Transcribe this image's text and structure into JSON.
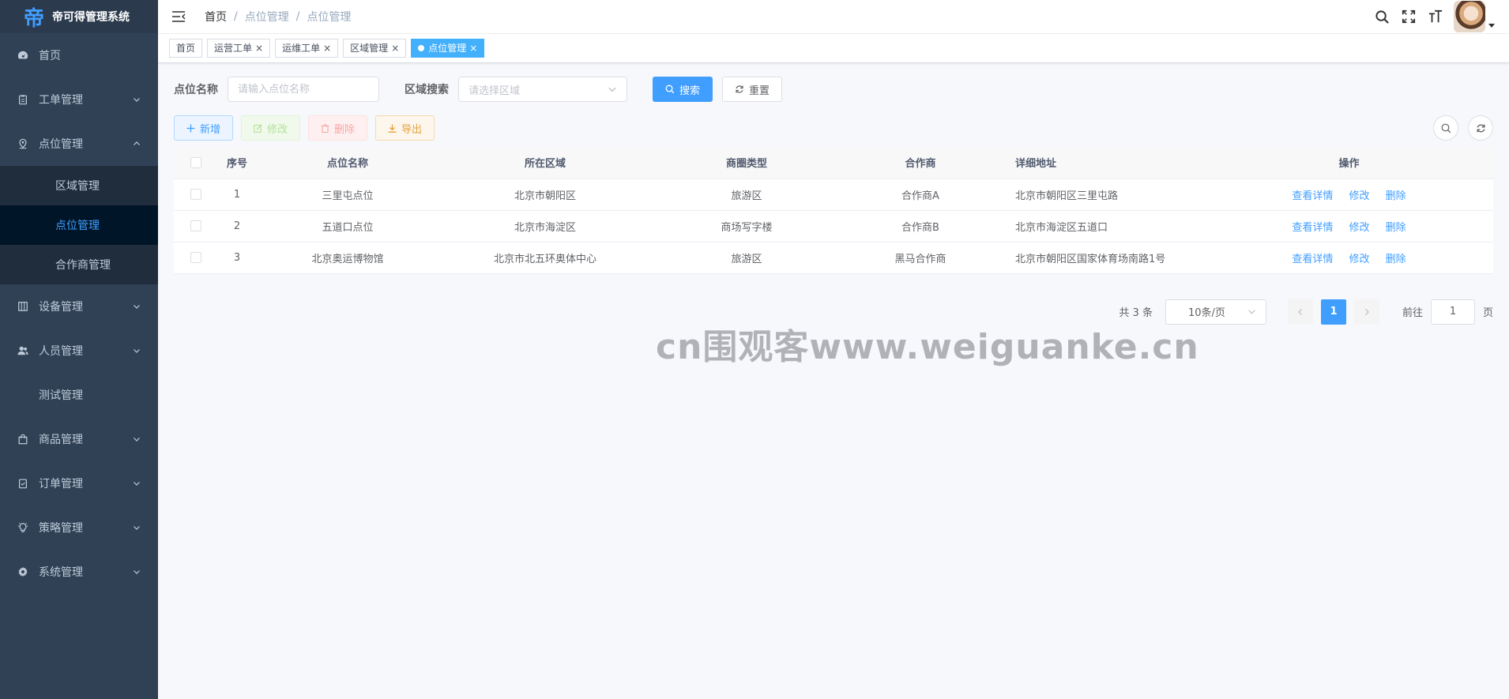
{
  "app": {
    "title": "帝可得管理系统",
    "logo_glyph": "帝"
  },
  "sidebar": {
    "items": [
      {
        "label": "首页",
        "icon": "dashboard-icon"
      },
      {
        "label": "工单管理",
        "icon": "clipboard-icon"
      },
      {
        "label": "点位管理",
        "icon": "location-icon"
      },
      {
        "label": "设备管理",
        "icon": "device-icon"
      },
      {
        "label": "人员管理",
        "icon": "people-icon"
      },
      {
        "label": "测试管理"
      },
      {
        "label": "商品管理",
        "icon": "bag-icon"
      },
      {
        "label": "订单管理",
        "icon": "order-icon"
      },
      {
        "label": "策略管理",
        "icon": "bulb-icon"
      },
      {
        "label": "系统管理",
        "icon": "gear-icon"
      }
    ],
    "submenu": [
      {
        "label": "区域管理"
      },
      {
        "label": "点位管理"
      },
      {
        "label": "合作商管理"
      }
    ]
  },
  "breadcrumb": [
    "首页",
    "/",
    "点位管理",
    "/",
    "点位管理"
  ],
  "tags": [
    {
      "label": "首页"
    },
    {
      "label": "运营工单",
      "close": "×"
    },
    {
      "label": "运维工单",
      "close": "×"
    },
    {
      "label": "区域管理",
      "close": "×"
    },
    {
      "label": "点位管理",
      "close": "×"
    }
  ],
  "search": {
    "name_label": "点位名称",
    "name_placeholder": "请输入点位名称",
    "region_label": "区域搜索",
    "region_placeholder": "请选择区域",
    "search_btn": "搜索",
    "reset_btn": "重置"
  },
  "toolbar": {
    "add": "新增",
    "edit": "修改",
    "delete": "删除",
    "export": "导出"
  },
  "table": {
    "headers": [
      "序号",
      "点位名称",
      "所在区域",
      "商圈类型",
      "合作商",
      "详细地址",
      "操作"
    ],
    "rows": [
      {
        "index": "1",
        "name": "三里屯点位",
        "region": "北京市朝阳区",
        "business": "旅游区",
        "partner": "合作商A",
        "address": "北京市朝阳区三里屯路"
      },
      {
        "index": "2",
        "name": "五道口点位",
        "region": "北京市海淀区",
        "business": "商场写字楼",
        "partner": "合作商B",
        "address": "北京市海淀区五道口"
      },
      {
        "index": "3",
        "name": "北京奥运博物馆",
        "region": "北京市北五环奥体中心",
        "business": "旅游区",
        "partner": "黑马合作商",
        "address": "北京市朝阳区国家体育场南路1号"
      }
    ],
    "ops": {
      "view": "查看详情",
      "edit": "修改",
      "delete": "删除"
    }
  },
  "pagination": {
    "total": "共 3 条",
    "page_size": "10条/页",
    "current": "1",
    "goto_label": "前往",
    "goto_value": "1",
    "page_suffix": "页"
  },
  "watermark": "cn围观客www.weiguanke.cn",
  "colors": {
    "sidebar_bg": "#304156",
    "primary": "#409eff",
    "active_tag": "#42b0fb"
  }
}
